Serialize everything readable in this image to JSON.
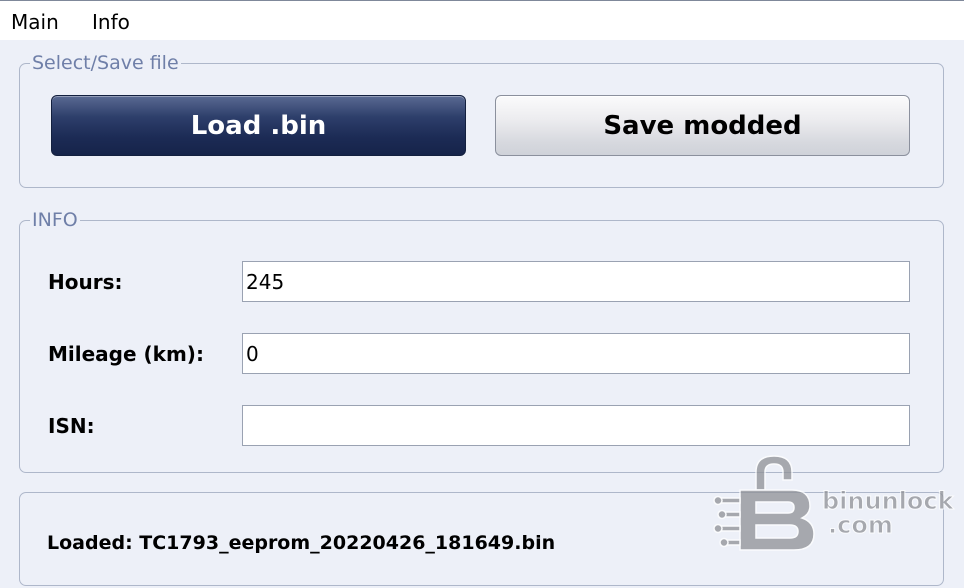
{
  "menu": {
    "items": [
      {
        "label": "Main"
      },
      {
        "label": "Info"
      }
    ]
  },
  "file_group": {
    "title": "Select/Save file",
    "load_button": "Load .bin",
    "save_button": "Save modded"
  },
  "info_group": {
    "title": "INFO",
    "fields": [
      {
        "label": "Hours:",
        "value": "245"
      },
      {
        "label": "Mileage (km):",
        "value": "0"
      },
      {
        "label": "ISN:",
        "value": ""
      }
    ]
  },
  "status": {
    "text": "Loaded: TC1793_eeprom_20220426_181649.bin"
  },
  "watermark": {
    "line1": "binunlock",
    "line2": ".com",
    "icon": "padlock-circuit-logo"
  },
  "colors": {
    "window_bg": "#edf0f8",
    "group_title": "#6f7fa8",
    "primary_button": "#1c2b55"
  }
}
